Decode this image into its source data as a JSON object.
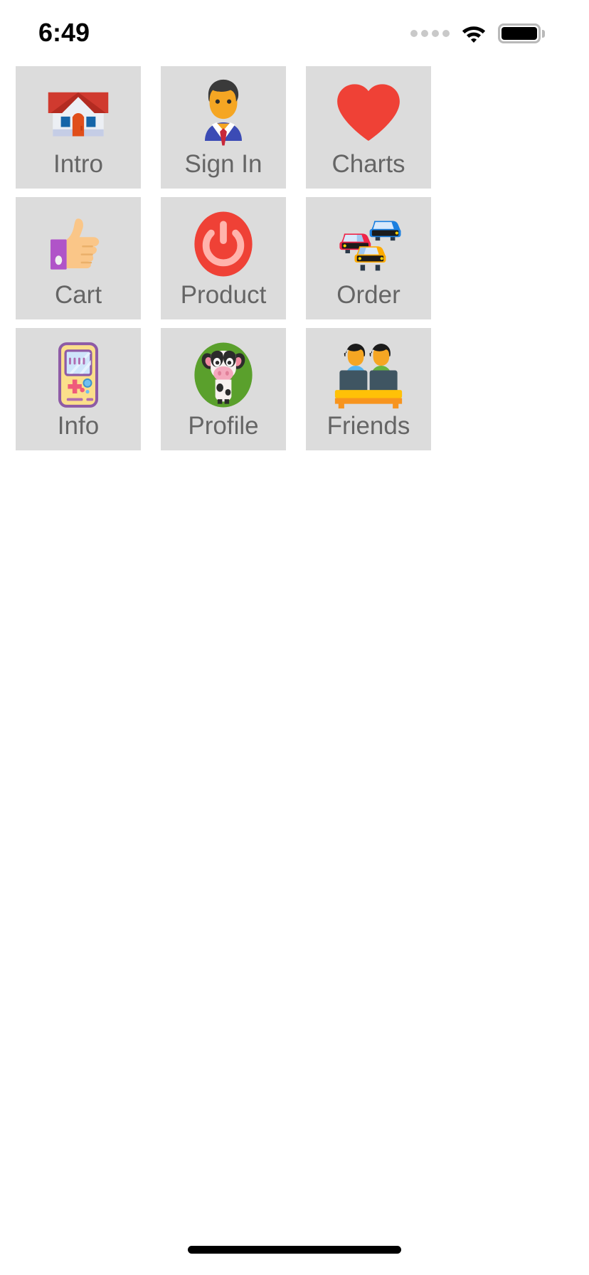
{
  "status_bar": {
    "time": "6:49",
    "signal_dots": 4,
    "signal_icon": "signal-dots-icon",
    "wifi_icon": "wifi-icon",
    "battery_icon": "battery-full-icon",
    "battery_level_full": true
  },
  "colors": {
    "page_background": "#ffffff",
    "tile_background": "#dcdcdc",
    "tile_label": "#656565",
    "status_text": "#000000",
    "signal_dot": "#c9c9c9",
    "battery_outline": "#b9b9b9",
    "home_indicator": "#000000",
    "accent_red": "#ef4136",
    "accent_green": "#5aa02c",
    "accent_orange": "#f7941e"
  },
  "grid": {
    "rows": [
      [
        {
          "label": "Intro",
          "icon": "house-icon"
        },
        {
          "label": "Sign In",
          "icon": "man-in-suit-icon"
        },
        {
          "label": "Charts",
          "icon": "heart-icon"
        }
      ],
      [
        {
          "label": "Cart",
          "icon": "thumbs-up-icon"
        },
        {
          "label": "Product",
          "icon": "power-button-icon"
        },
        {
          "label": "Order",
          "icon": "cars-icon"
        }
      ],
      [
        {
          "label": "Info",
          "icon": "handheld-game-console-icon"
        },
        {
          "label": "Profile",
          "icon": "cow-face-icon"
        },
        {
          "label": "Friends",
          "icon": "two-people-at-desks-icon"
        }
      ]
    ]
  },
  "home_indicator": {
    "name": "home-indicator"
  }
}
